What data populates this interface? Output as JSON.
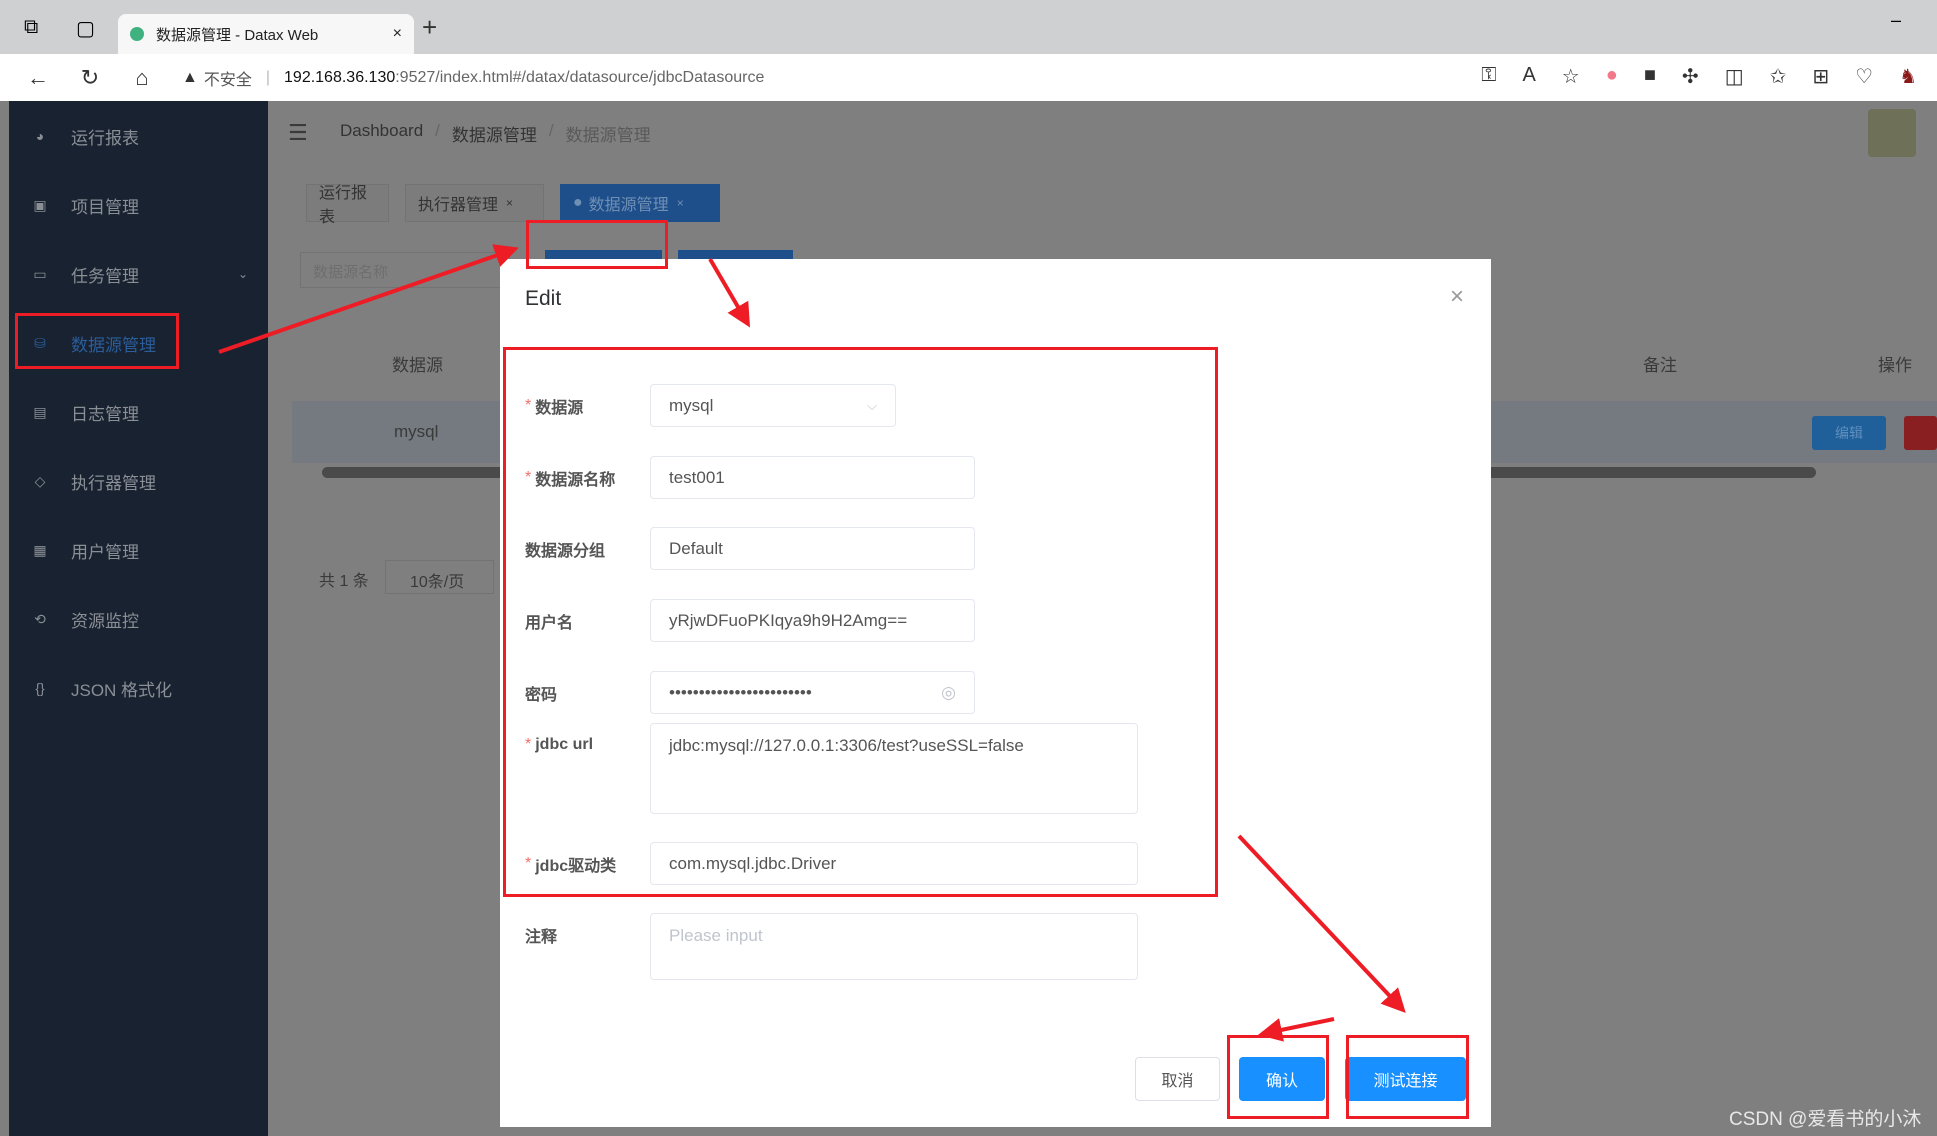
{
  "browser": {
    "tab_title": "数据源管理 - Datax Web",
    "tab_close": "×",
    "new_tab": "+",
    "security": "不安全",
    "url_host": "192.168.36.130",
    "url_rest": ":9527/index.html#/datax/datasource/jdbcDatasource",
    "minimize": "–"
  },
  "sidebar": {
    "items": [
      {
        "label": "运行报表",
        "icon": "dashboard-icon"
      },
      {
        "label": "项目管理",
        "icon": "project-icon"
      },
      {
        "label": "任务管理",
        "icon": "task-icon"
      },
      {
        "label": "数据源管理",
        "icon": "database-icon",
        "active": true
      },
      {
        "label": "日志管理",
        "icon": "log-icon"
      },
      {
        "label": "执行器管理",
        "icon": "executor-icon"
      },
      {
        "label": "用户管理",
        "icon": "user-icon"
      },
      {
        "label": "资源监控",
        "icon": "monitor-icon"
      },
      {
        "label": "JSON 格式化",
        "icon": "json-icon"
      }
    ]
  },
  "breadcrumb": [
    "Dashboard",
    "数据源管理",
    "数据源管理"
  ],
  "tags": [
    {
      "label": "运行报表"
    },
    {
      "label": "执行器管理",
      "close": "×"
    },
    {
      "label": "数据源管理",
      "close": "×",
      "active": true
    }
  ],
  "search": {
    "placeholder": "数据源名称"
  },
  "table": {
    "headers": [
      "数据源",
      "备注",
      "操作"
    ],
    "rows": [
      {
        "datasource": "mysql",
        "edit": "编辑"
      }
    ]
  },
  "pagination": {
    "total": "共 1 条",
    "page_size": "10条/页"
  },
  "modal": {
    "title": "Edit",
    "close": "×",
    "fields": [
      {
        "label": "数据源",
        "required": true,
        "value": "mysql",
        "type": "select"
      },
      {
        "label": "数据源名称",
        "required": true,
        "value": "test001"
      },
      {
        "label": "数据源分组",
        "required": false,
        "value": "Default"
      },
      {
        "label": "用户名",
        "required": false,
        "value": "yRjwDFuoPKIqya9h9H2Amg=="
      },
      {
        "label": "密码",
        "required": false,
        "value": "••••••••••••••••••••••••",
        "type": "password"
      },
      {
        "label": "jdbc url",
        "required": true,
        "value": "jdbc:mysql://127.0.0.1:3306/test?useSSL=false",
        "type": "textarea"
      },
      {
        "label": "jdbc驱动类",
        "required": true,
        "value": "com.mysql.jdbc.Driver"
      },
      {
        "label": "注释",
        "required": false,
        "placeholder": "Please input",
        "type": "textarea"
      }
    ],
    "cancel": "取消",
    "confirm": "确认",
    "test": "测试连接"
  },
  "watermark": "CSDN @爱看书的小沐",
  "colors": {
    "primary": "#1890ff",
    "annotation": "#ee1c25",
    "sidebar": "#1f2d3d"
  }
}
